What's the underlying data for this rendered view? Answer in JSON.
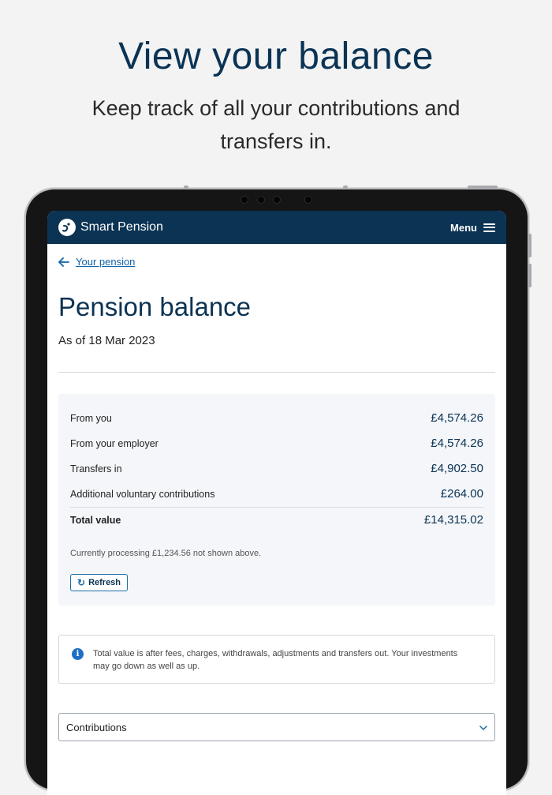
{
  "promo": {
    "title": "View your balance",
    "subtitle": "Keep track of all your contributions and transfers in."
  },
  "app": {
    "brand": "Smart Pension",
    "menu_label": "Menu",
    "back_link": "Your pension",
    "page_title": "Pension balance",
    "as_of": "As of 18 Mar 2023",
    "summary": {
      "rows": [
        {
          "label": "From you",
          "value": "£4,574.26"
        },
        {
          "label": "From your employer",
          "value": "£4,574.26"
        },
        {
          "label": "Transfers in",
          "value": "£4,902.50"
        },
        {
          "label": "Additional voluntary contributions",
          "value": "£264.00"
        }
      ],
      "total": {
        "label": "Total value",
        "value": "£14,315.02"
      },
      "processing_note": "Currently processing £1,234.56 not shown above.",
      "refresh_label": "Refresh"
    },
    "info_text": "Total value is after fees, charges, withdrawals, adjustments and transfers out. Your investments may go down as well as up.",
    "accordion_label": "Contributions"
  },
  "icons": {
    "logo": "smart-pension-logo-icon",
    "menu": "hamburger-icon",
    "back": "arrow-left-icon",
    "refresh": "refresh-icon",
    "info": "info-icon",
    "accordion": "chevron-down-icon"
  },
  "colors": {
    "navy": "#0b3354",
    "link": "#0f63a8",
    "summary_bg": "#f4f6f9",
    "info_blue": "#1f6fc7"
  }
}
